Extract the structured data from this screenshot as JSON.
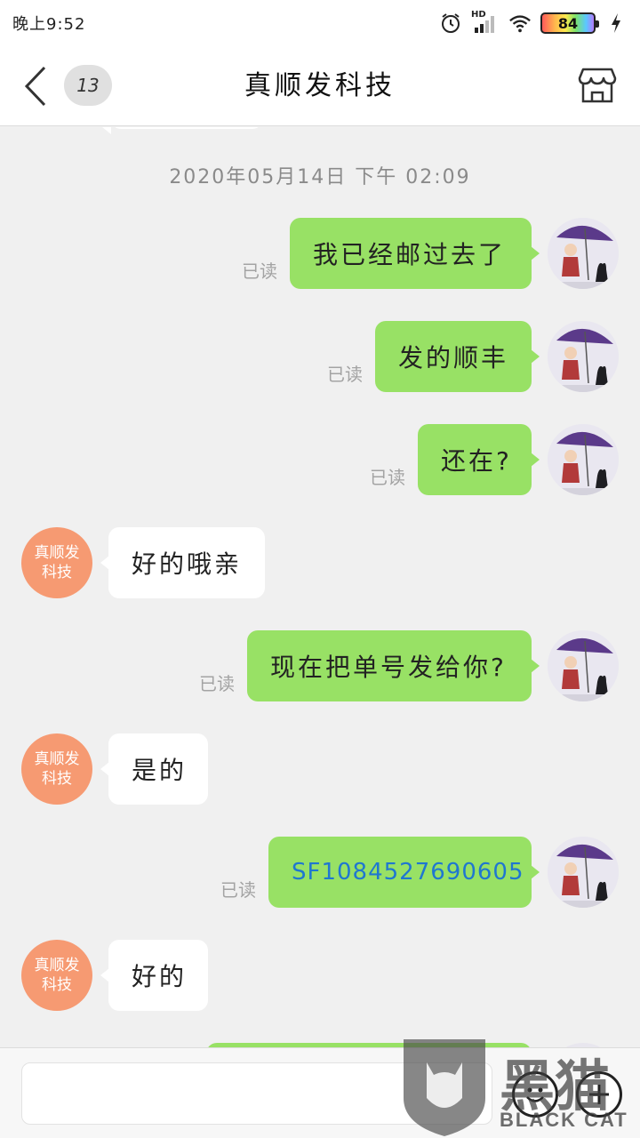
{
  "status_bar": {
    "time": "晚上9:52",
    "network_label": "HD",
    "battery": "84"
  },
  "header": {
    "unread_count": "13",
    "title": "真顺发科技"
  },
  "chat": {
    "timestamp": "2020年05月14日 下午 02:09",
    "shop_avatar_line1": "真顺发",
    "shop_avatar_line2": "科技",
    "messages": [
      {
        "side": "sent",
        "text": "我已经邮过去了",
        "receipt": "已读"
      },
      {
        "side": "sent",
        "text": "发的顺丰",
        "receipt": "已读"
      },
      {
        "side": "sent",
        "text": "还在?",
        "receipt": "已读"
      },
      {
        "side": "recv",
        "text": "好的哦亲"
      },
      {
        "side": "sent",
        "text": "现在把单号发给你?",
        "receipt": "已读"
      },
      {
        "side": "recv",
        "text": "是的"
      },
      {
        "side": "sent",
        "text": "SF1084527690605",
        "receipt": "已读"
      },
      {
        "side": "recv",
        "text": "好的"
      }
    ]
  },
  "input": {
    "placeholder": ""
  },
  "watermark": {
    "cn": "黑猫",
    "en": "BLACK CAT"
  },
  "colors": {
    "sent_bubble": "#98e165",
    "recv_bubble": "#ffffff",
    "shop_avatar": "#f69a72",
    "link": "#1f77d0"
  }
}
